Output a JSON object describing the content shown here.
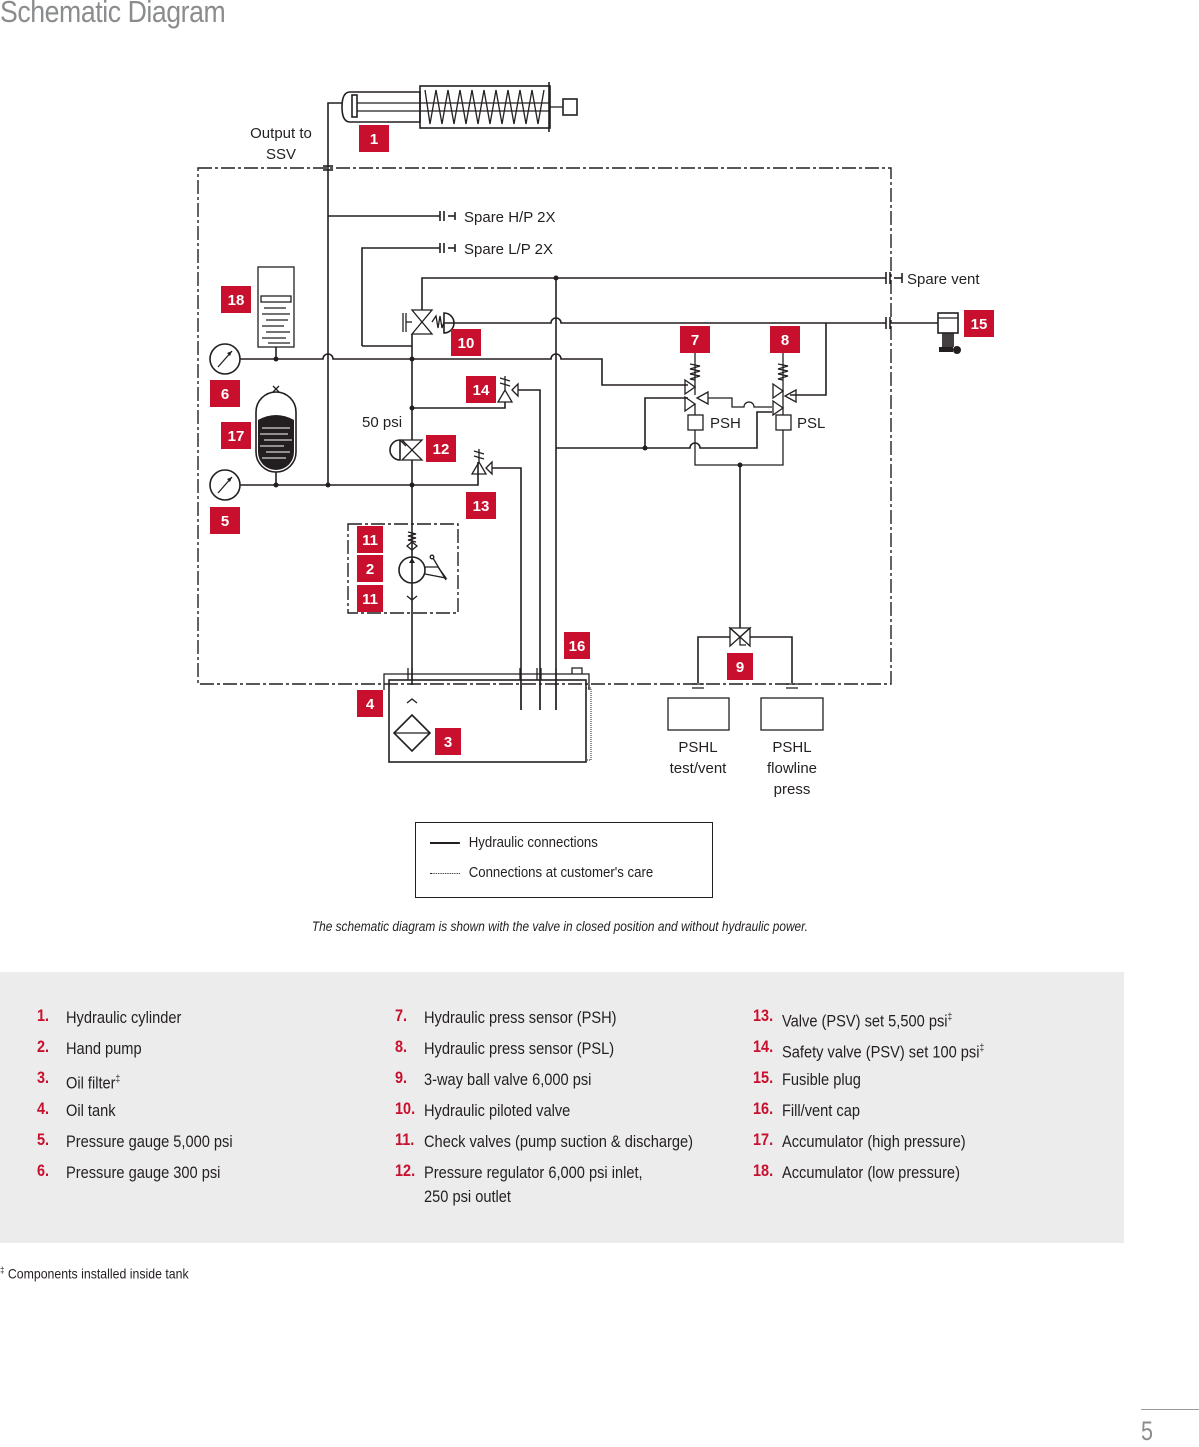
{
  "page": {
    "title": "Schematic Diagram",
    "page_number": "5"
  },
  "diagram": {
    "labels": {
      "output_to": "Output to",
      "ssv": "SSV",
      "spare_hp": "Spare H/P 2X",
      "spare_lp": "Spare L/P 2X",
      "spare_vent": "Spare vent",
      "regulator_setting": "50 psi",
      "psh": "PSH",
      "psl": "PSL",
      "pshl_test_1": "PSHL",
      "pshl_test_2": "test/vent",
      "pshl_flow_1": "PSHL",
      "pshl_flow_2": "flowline",
      "pshl_flow_3": "press"
    },
    "badges": {
      "b1": "1",
      "b2": "2",
      "b3": "3",
      "b4": "4",
      "b5": "5",
      "b6": "6",
      "b7": "7",
      "b8": "8",
      "b9": "9",
      "b10": "10",
      "b11a": "11",
      "b11b": "11",
      "b12": "12",
      "b13": "13",
      "b14": "14",
      "b15": "15",
      "b16": "16",
      "b17": "17",
      "b18": "18"
    },
    "accent_color": "#c8102e"
  },
  "legend": {
    "solid_label": "Hydraulic connections",
    "dotted_label": "Connections at customer's care"
  },
  "caption": "The schematic diagram is shown with the valve in closed position and without hydraulic power.",
  "parts": {
    "col1": [
      {
        "num": "1.",
        "text": "Hydraulic cylinder",
        "mark": ""
      },
      {
        "num": "2.",
        "text": "Hand pump",
        "mark": ""
      },
      {
        "num": "3.",
        "text": "Oil filter",
        "mark": "‡"
      },
      {
        "num": "4.",
        "text": "Oil tank",
        "mark": ""
      },
      {
        "num": "5.",
        "text": "Pressure gauge 5,000 psi",
        "mark": ""
      },
      {
        "num": "6.",
        "text": "Pressure gauge 300 psi",
        "mark": ""
      }
    ],
    "col2": [
      {
        "num": "7.",
        "text": "Hydraulic press sensor (PSH)",
        "mark": ""
      },
      {
        "num": "8.",
        "text": "Hydraulic press sensor (PSL)",
        "mark": ""
      },
      {
        "num": "9.",
        "text": "3-way ball valve 6,000 psi",
        "mark": ""
      },
      {
        "num": "10.",
        "text": "Hydraulic piloted valve",
        "mark": ""
      },
      {
        "num": "11.",
        "text": "Check valves (pump suction & discharge)",
        "mark": ""
      },
      {
        "num": "12.",
        "text": "Pressure regulator 6,000 psi inlet,",
        "mark": "",
        "text2": "250 psi outlet"
      }
    ],
    "col3": [
      {
        "num": "13.",
        "text": "Valve (PSV) set 5,500 psi",
        "mark": "‡"
      },
      {
        "num": "14.",
        "text": "Safety valve (PSV) set 100 psi",
        "mark": "‡"
      },
      {
        "num": "15.",
        "text": "Fusible plug",
        "mark": ""
      },
      {
        "num": "16.",
        "text": "Fill/vent cap",
        "mark": ""
      },
      {
        "num": "17.",
        "text": "Accumulator (high pressure)",
        "mark": ""
      },
      {
        "num": "18.",
        "text": "Accumulator (low pressure)",
        "mark": ""
      }
    ]
  },
  "footnote": {
    "mark": "‡",
    "text": " Components installed inside tank"
  }
}
